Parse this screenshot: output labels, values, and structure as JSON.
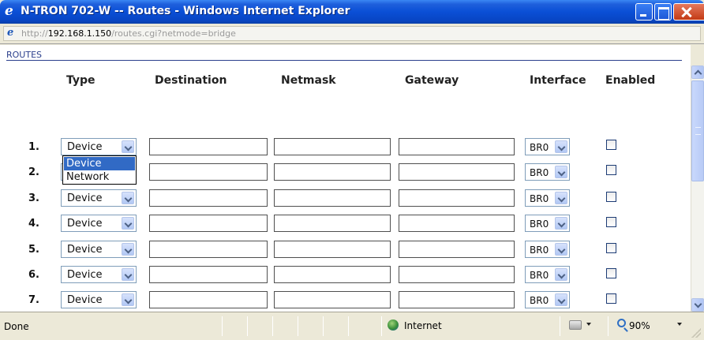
{
  "window": {
    "title": "N-TRON 702-W -- Routes - Windows Internet Explorer",
    "icon": "ie-icon"
  },
  "address": {
    "prefix": "http://",
    "host": "192.168.1.150",
    "path": "/routes.cgi?netmode=bridge"
  },
  "section_title": "ROUTES",
  "columns": [
    "Type",
    "Destination",
    "Netmask",
    "Gateway",
    "Interface",
    "Enabled"
  ],
  "rows": [
    {
      "num": "1.",
      "type": "Device",
      "destination": "",
      "netmask": "",
      "gateway": "",
      "interface": "BR0",
      "enabled": false
    },
    {
      "num": "2.",
      "type": "Device",
      "destination": "",
      "netmask": "",
      "gateway": "",
      "interface": "BR0",
      "enabled": false
    },
    {
      "num": "3.",
      "type": "Device",
      "destination": "",
      "netmask": "",
      "gateway": "",
      "interface": "BR0",
      "enabled": false
    },
    {
      "num": "4.",
      "type": "Device",
      "destination": "",
      "netmask": "",
      "gateway": "",
      "interface": "BR0",
      "enabled": false
    },
    {
      "num": "5.",
      "type": "Device",
      "destination": "",
      "netmask": "",
      "gateway": "",
      "interface": "BR0",
      "enabled": false
    },
    {
      "num": "6.",
      "type": "Device",
      "destination": "",
      "netmask": "",
      "gateway": "",
      "interface": "BR0",
      "enabled": false
    },
    {
      "num": "7.",
      "type": "Device",
      "destination": "",
      "netmask": "",
      "gateway": "",
      "interface": "BR0",
      "enabled": false
    }
  ],
  "dropdown_open": {
    "options": [
      "Device",
      "Network"
    ],
    "selected": "Device"
  },
  "status": {
    "text": "Done",
    "zone": "Internet",
    "zoom": "90%"
  },
  "colors": {
    "titlebar": "#0a4fd6",
    "section_title": "#2b3f8c",
    "dropdown_selected": "#316ac5"
  }
}
